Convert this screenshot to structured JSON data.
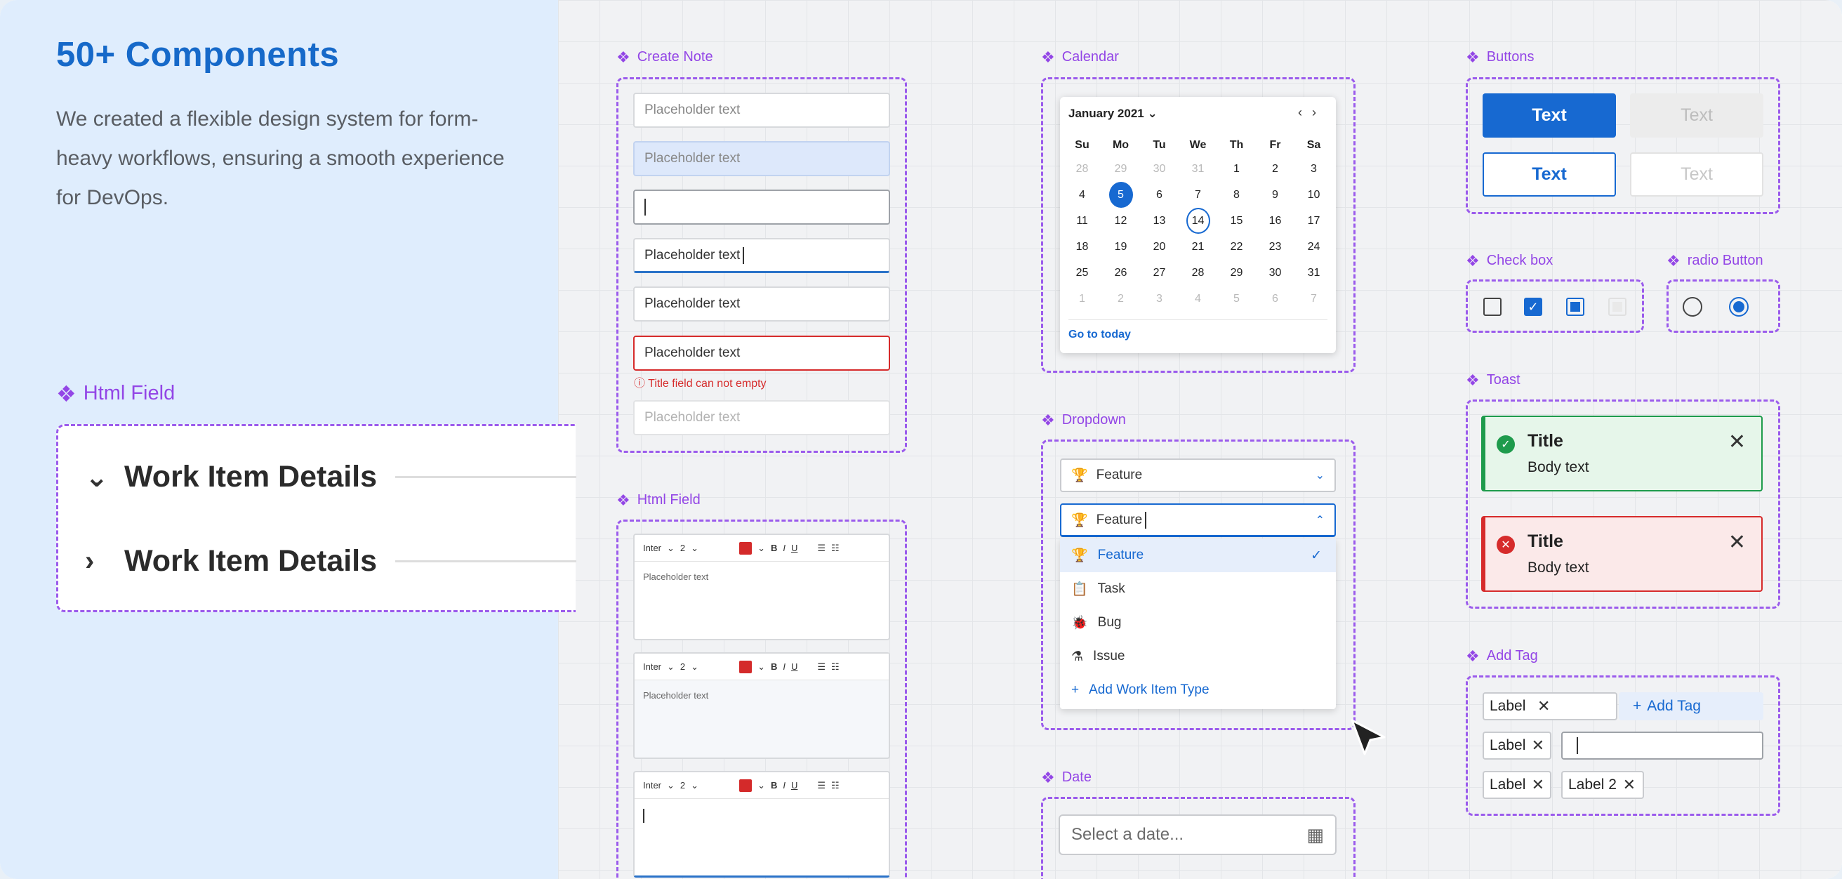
{
  "hero": {
    "title": "50+ Components",
    "description": "We created a flexible design system for form-heavy workflows, ensuring a smooth experience for DevOps."
  },
  "labels": {
    "html_field_big": "Html Field",
    "create_note": "Create Note",
    "html_field": "Html Field",
    "calendar": "Calendar",
    "dropdown": "Dropdown",
    "date": "Date",
    "buttons": "Buttons",
    "checkbox": "Check box",
    "radio": "radio Button",
    "toast": "Toast",
    "add_tag": "Add Tag"
  },
  "work_items": [
    {
      "title": "Work Item Details",
      "state": "expanded"
    },
    {
      "title": "Work Item Details",
      "state": "collapsed"
    }
  ],
  "inputs": {
    "placeholder": "Placeholder text",
    "error": "Title field can not empty"
  },
  "rte": {
    "font": "Inter",
    "size": "2",
    "bold": "B",
    "italic": "I",
    "underline": "U",
    "placeholder": "Placeholder text"
  },
  "calendar": {
    "month": "January 2021",
    "weekdays": [
      "Su",
      "Mo",
      "Tu",
      "We",
      "Th",
      "Fr",
      "Sa"
    ],
    "days": [
      "28",
      "29",
      "30",
      "31",
      "1",
      "2",
      "3",
      "4",
      "5",
      "6",
      "7",
      "8",
      "9",
      "10",
      "11",
      "12",
      "13",
      "14",
      "15",
      "16",
      "17",
      "18",
      "19",
      "20",
      "21",
      "22",
      "23",
      "24",
      "25",
      "26",
      "27",
      "28",
      "29",
      "30",
      "31",
      "1",
      "2",
      "3",
      "4",
      "5",
      "6",
      "7"
    ],
    "selected": "5",
    "today": "14",
    "go_today": "Go to today"
  },
  "dropdown": {
    "value": "Feature",
    "options": [
      "Feature",
      "Task",
      "Bug",
      "Issue"
    ],
    "add": "Add Work Item Type"
  },
  "date": {
    "placeholder": "Select a date..."
  },
  "buttons": {
    "label": "Text"
  },
  "toast": {
    "title": "Title",
    "body": "Body text"
  },
  "tags": {
    "label": "Label",
    "label2": "Label 2",
    "add": "Add Tag"
  },
  "colors": {
    "accent": "#1769d1",
    "purple": "#9346e6",
    "success": "#1e9b4c",
    "error": "#d62b2b"
  }
}
